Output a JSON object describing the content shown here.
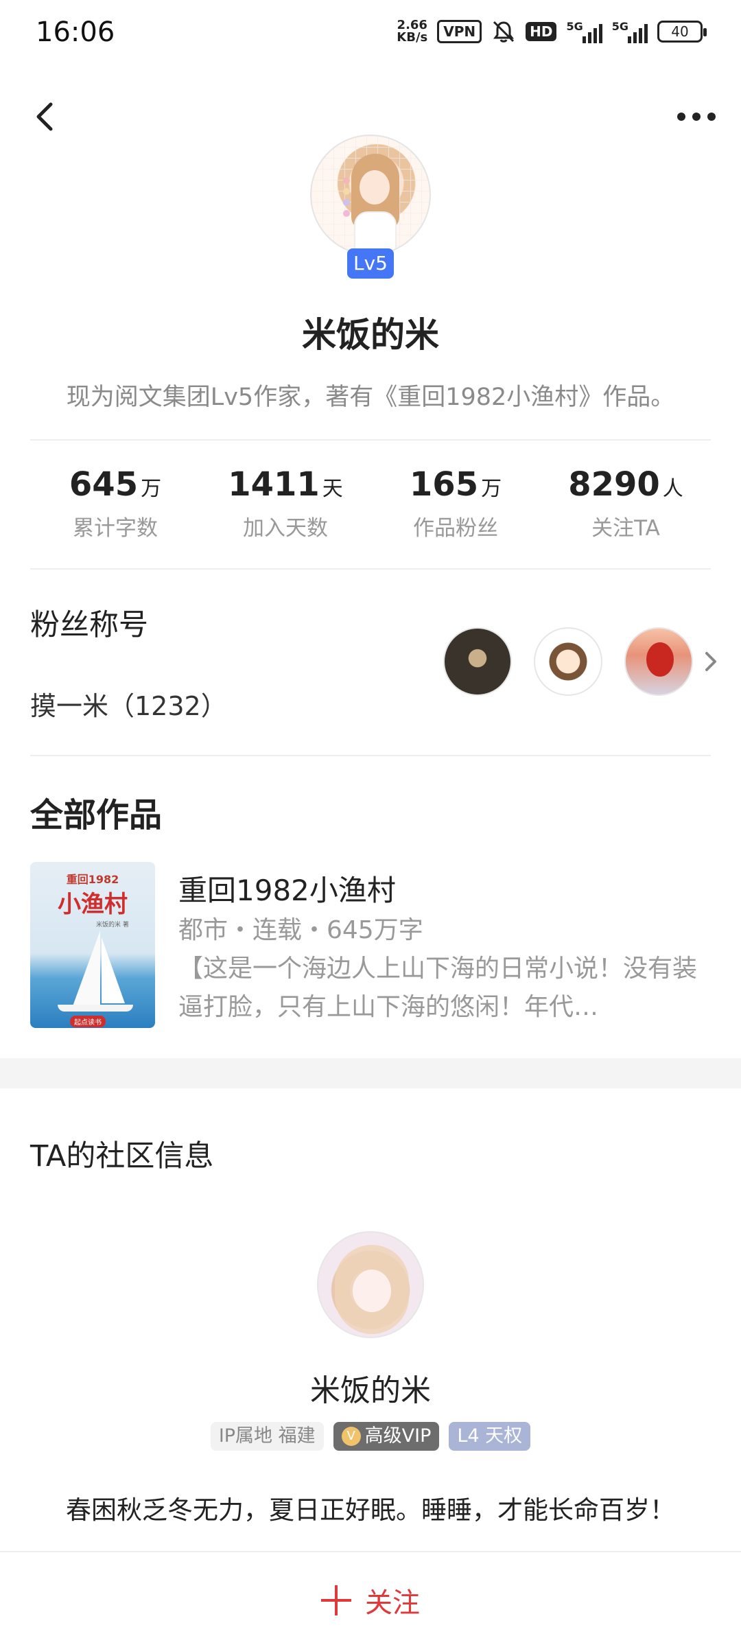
{
  "status_bar": {
    "time": "16:06",
    "net_speed_value": "2.66",
    "net_speed_unit": "KB/s",
    "vpn": "VPN",
    "hd": "HD",
    "signal1_label": "5G",
    "signal2_label": "5G",
    "battery": "40"
  },
  "header": {
    "back_icon": "chevron-left-icon",
    "more_icon": "more-dots-icon"
  },
  "profile": {
    "level_badge": "Lv5",
    "name": "米饭的米",
    "description": "现为阅文集团Lv5作家，著有《重回1982小渔村》作品。"
  },
  "stats": [
    {
      "value": "645",
      "unit": "万",
      "label": "累计字数"
    },
    {
      "value": "1411",
      "unit": "天",
      "label": "加入天数"
    },
    {
      "value": "165",
      "unit": "万",
      "label": "作品粉丝"
    },
    {
      "value": "8290",
      "unit": "人",
      "label": "关注TA"
    }
  ],
  "fans": {
    "title": "粉丝称号",
    "badge": "摸一米（1232）"
  },
  "works": {
    "title": "全部作品",
    "book": {
      "cover_small": "重回1982",
      "cover_big": "小渔村",
      "cover_author": "米饭的米 著",
      "cover_logo": "起点读书",
      "title": "重回1982小渔村",
      "meta": "都市・连载・645万字",
      "summary": "【这是一个海边人上山下海的日常小说！没有装逼打脸，只有上山下海的悠闲！年代…"
    }
  },
  "community": {
    "title": "TA的社区信息",
    "name": "米饭的米",
    "tags": {
      "ip": "IP属地 福建",
      "vip": "高级VIP",
      "level": "L4 天权"
    },
    "signature": "春困秋乏冬无力，夏日正好眠。睡睡，才能长命百岁！"
  },
  "bottom_bar": {
    "follow_label": "关注"
  },
  "colors": {
    "accent_red": "#e0393b",
    "level_blue": "#4476f5",
    "muted_text": "#999999"
  }
}
